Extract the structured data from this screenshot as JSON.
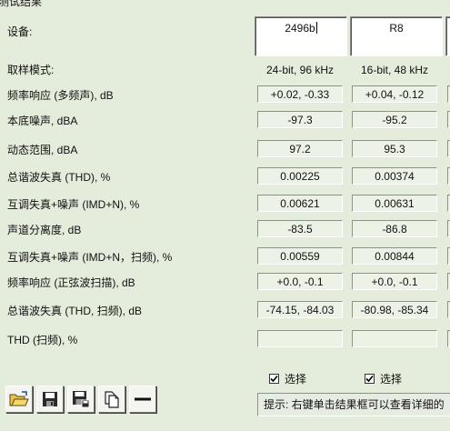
{
  "window": {
    "title": "测试结果"
  },
  "header": {
    "device_label": "设备:"
  },
  "devices": [
    {
      "name": "2496b",
      "sample_mode": "24-bit, 96 kHz"
    },
    {
      "name": "R8",
      "sample_mode": "16-bit, 48 kHz"
    }
  ],
  "rows": [
    {
      "label": "取样模式:"
    },
    {
      "label": "频率响应 (多频声), dB",
      "values": [
        "+0.02, -0.33",
        "+0.04, -0.12"
      ]
    },
    {
      "label": "本底噪声, dBA",
      "values": [
        "-97.3",
        "-95.2"
      ]
    },
    {
      "label": "动态范围, dBA",
      "values": [
        "97.2",
        "95.3"
      ]
    },
    {
      "label": "总谐波失真 (THD), %",
      "values": [
        "0.00225",
        "0.00374"
      ]
    },
    {
      "label": "互调失真+噪声 (IMD+N), %",
      "values": [
        "0.00621",
        "0.00631"
      ]
    },
    {
      "label": "声道分离度, dB",
      "values": [
        "-83.5",
        "-86.8"
      ]
    },
    {
      "label": "互调失真+噪声 (IMD+N，扫频), %",
      "values": [
        "0.00559",
        "0.00844"
      ]
    },
    {
      "label": "频率响应 (正弦波扫描), dB",
      "values": [
        "+0.0, -0.1",
        "+0.0, -0.1"
      ]
    },
    {
      "label": "总谐波失真 (THD, 扫频), dB",
      "values": [
        "-74.15, -84.03",
        "-80.98, -85.34"
      ]
    },
    {
      "label": "THD (扫频), %",
      "values": [
        "",
        ""
      ]
    }
  ],
  "select": {
    "label": "选择",
    "checked": [
      true,
      true
    ]
  },
  "toolbar": {
    "icons": [
      "open-folder-icon",
      "save-icon",
      "save-as-icon",
      "copy-icon",
      "minus-icon"
    ]
  },
  "hint": {
    "text": "提示: 右键单击结果框可以查看详细的"
  }
}
